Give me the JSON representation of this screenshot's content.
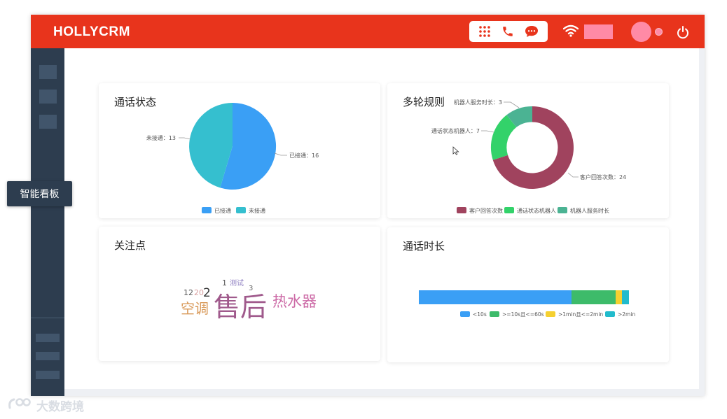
{
  "header": {
    "brand": "HOLLYCRM",
    "tools": [
      {
        "icon": "grid-icon"
      },
      {
        "icon": "phone-icon"
      },
      {
        "icon": "chat-icon"
      }
    ],
    "wifi_icon": "wifi-icon",
    "power_icon": "power-icon",
    "accent_color": "#e8341c"
  },
  "sidebar": {
    "tooltip": "智能看板"
  },
  "cards": {
    "call_status": {
      "title": "通话状态",
      "labels": [
        "已接通：16",
        "未接通：13"
      ],
      "legend": [
        "已接通",
        "未接通"
      ]
    },
    "multi_rule": {
      "title": "多轮规则",
      "labels": [
        "客户回答次数：24",
        "通话状态机器人：7",
        "机器人服务时长：3"
      ],
      "legend": [
        "客户回答次数",
        "通话状态机器人",
        "机器人服务时长"
      ]
    },
    "focus": {
      "title": "关注点",
      "words": [
        "售后",
        "空调",
        "热水器",
        "2",
        "12",
        "20",
        "1",
        "测试",
        "3"
      ]
    },
    "duration": {
      "title": "通话时长",
      "legend": [
        "<10s",
        ">=10s且<=60s",
        ">1min且<=2min",
        ">2min"
      ]
    }
  },
  "chart_data": [
    {
      "type": "pie",
      "title": "通话状态",
      "categories": [
        "已接通",
        "未接通"
      ],
      "values": [
        16,
        13
      ],
      "colors": [
        "#3a9ff5",
        "#35bfcf"
      ],
      "legend_position": "bottom"
    },
    {
      "type": "pie",
      "variant": "donut",
      "title": "多轮规则",
      "categories": [
        "客户回答次数",
        "通话状态机器人",
        "机器人服务时长"
      ],
      "values": [
        24,
        7,
        3
      ],
      "colors": [
        "#a0435e",
        "#33d26a",
        "#4bb393"
      ],
      "legend_position": "bottom"
    },
    {
      "type": "bar",
      "variant": "stacked-horizontal",
      "title": "通话时长",
      "categories": [
        "<10s",
        ">=10s且<=60s",
        ">1min且<=2min",
        ">2min"
      ],
      "values": [
        73,
        21,
        3,
        3
      ],
      "colors": [
        "#3a9ff5",
        "#3dbb6a",
        "#f5d030",
        "#22bbcc"
      ],
      "legend_position": "bottom"
    }
  ],
  "watermark": "大数跨境"
}
